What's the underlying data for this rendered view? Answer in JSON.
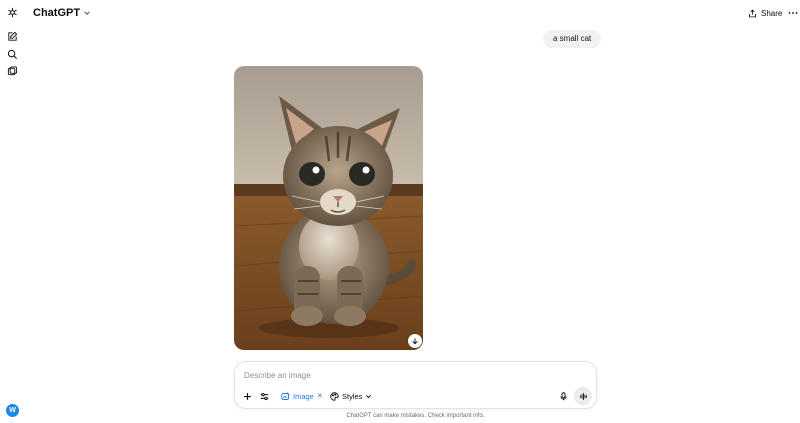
{
  "header": {
    "model_name": "ChatGPT",
    "share_label": "Share"
  },
  "rail": {
    "items": [
      {
        "icon": "logo-icon"
      },
      {
        "icon": "new-chat-icon"
      },
      {
        "icon": "search-icon"
      },
      {
        "icon": "library-icon"
      }
    ],
    "avatar_initial": "W"
  },
  "conversation": {
    "user_message": "a small cat",
    "generated_image": {
      "subject": "kitten"
    }
  },
  "composer": {
    "placeholder": "Describe an image",
    "image_chip_label": "Image",
    "styles_label": "Styles"
  },
  "footer": {
    "disclaimer": "ChatGPT can make mistakes. Check important info."
  },
  "colors": {
    "accent": "#1f7aec",
    "bubble": "#f2f2f2",
    "avatar": "#1e88e5"
  }
}
